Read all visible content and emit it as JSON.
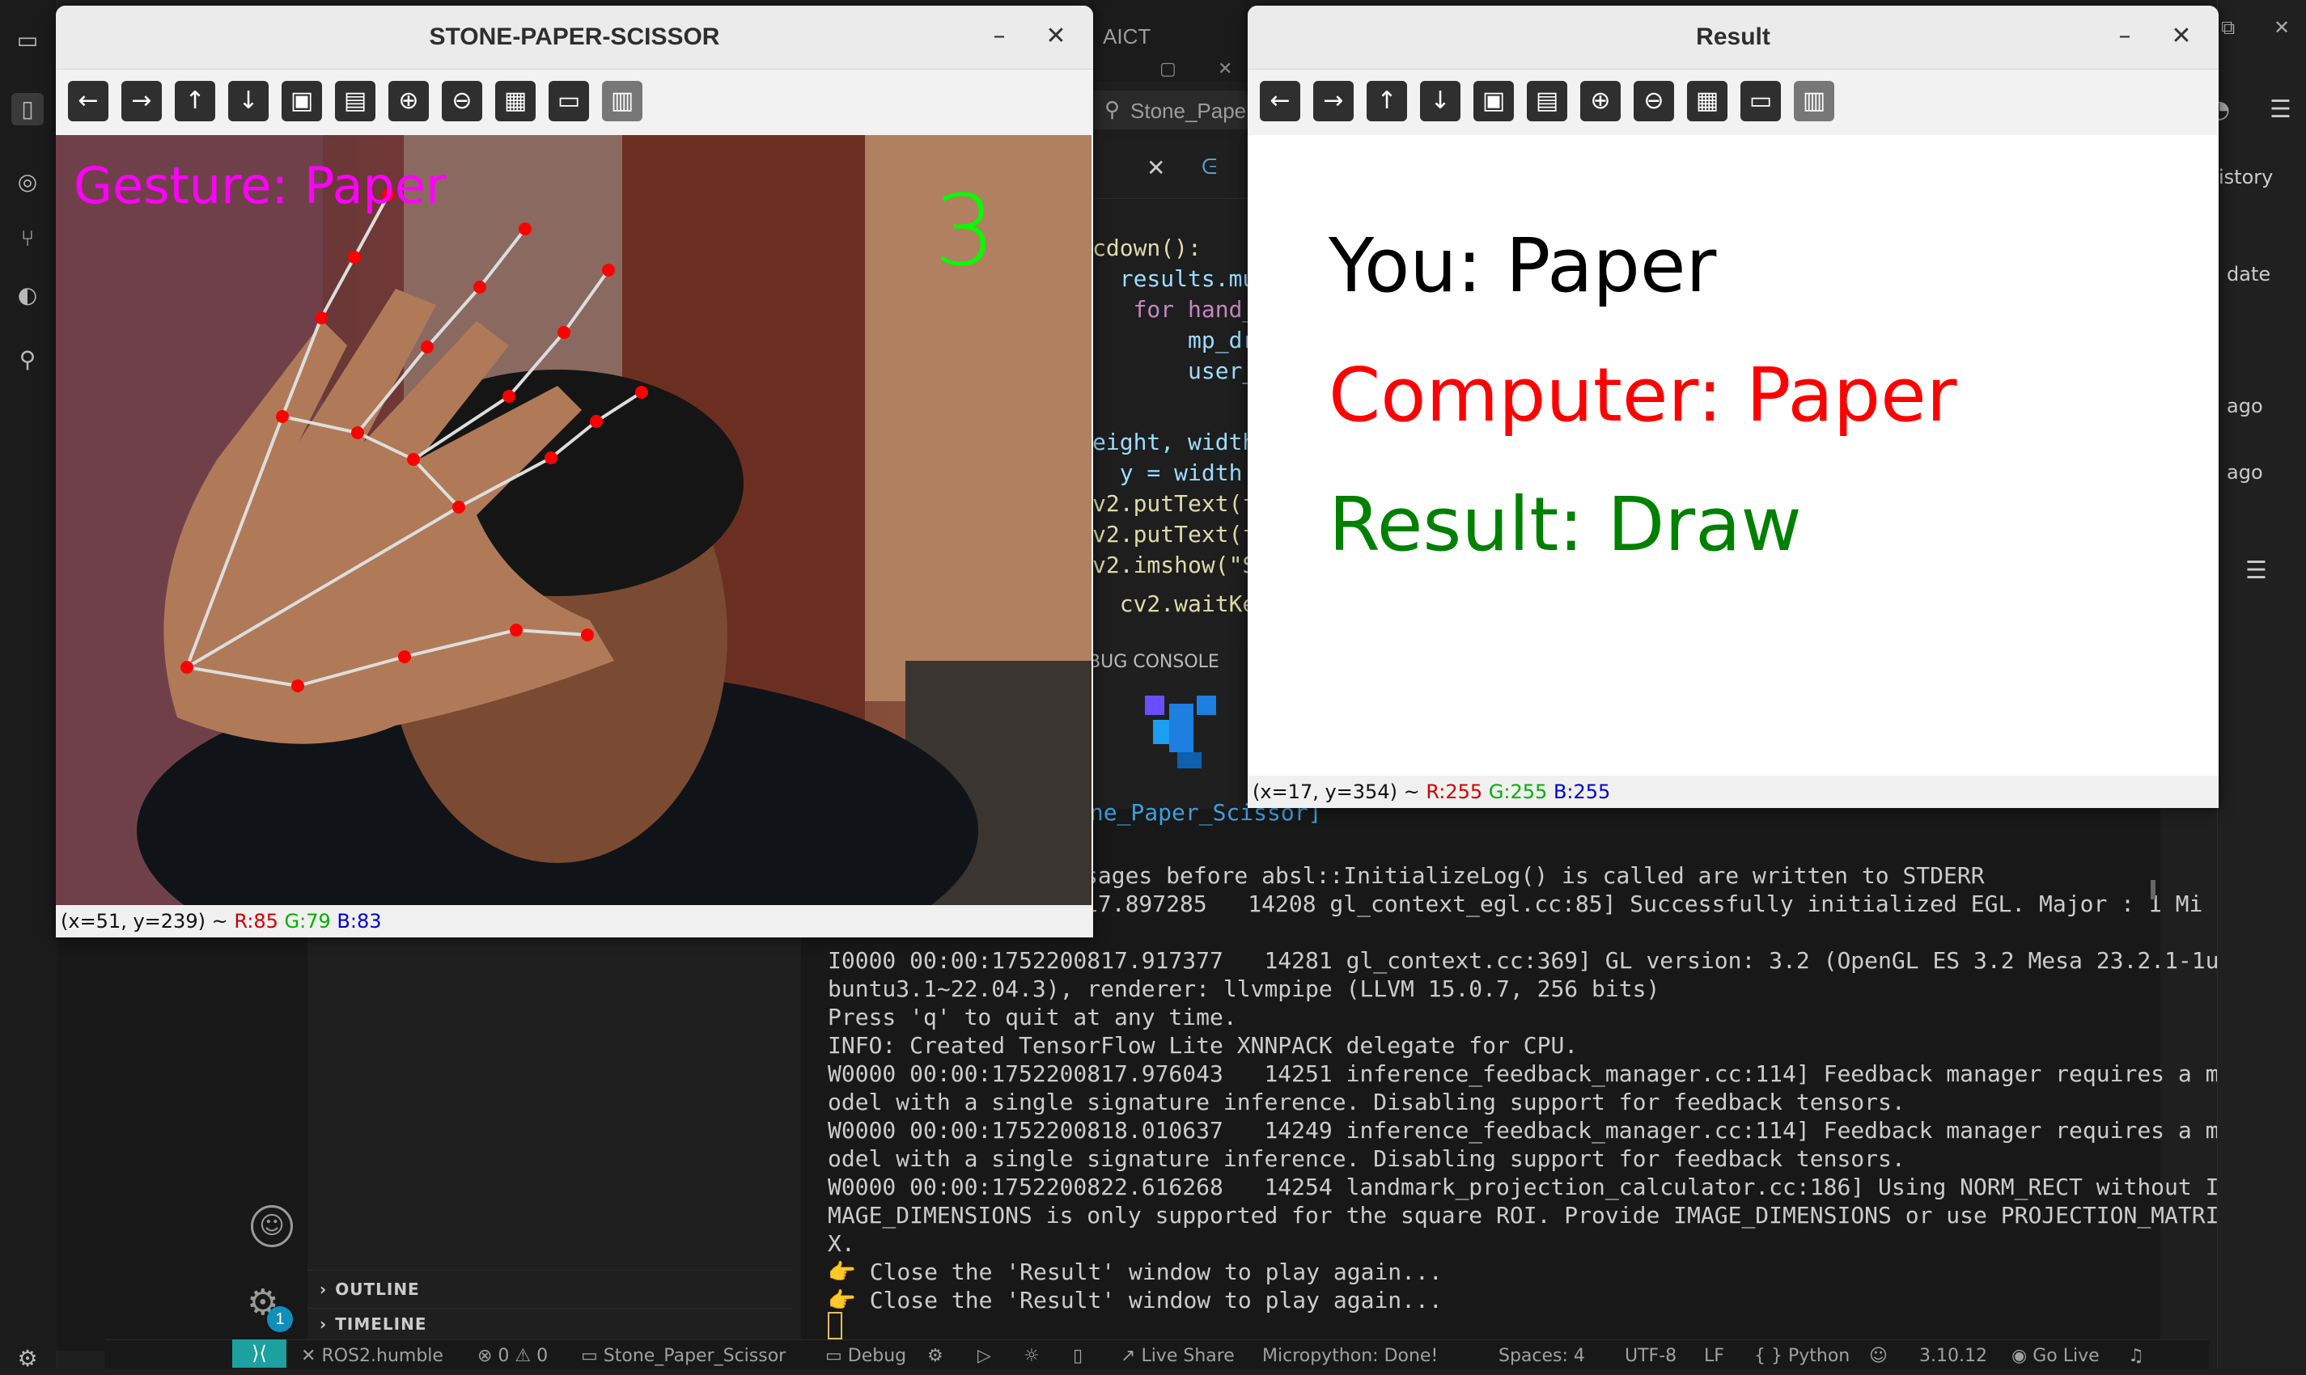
{
  "colors": {
    "gesture_text": "#ff00ff",
    "countdown": "#00ff00",
    "you_text": "#000000",
    "computer_text": "#ff0000",
    "result_text": "#008000",
    "landmark_point": "#ff0000",
    "landmark_line": "#dddddd"
  },
  "camera_window": {
    "title": "STONE-PAPER-SCISSOR",
    "minimize_icon": "–",
    "close_icon": "✕",
    "overlay": {
      "gesture_label": "Gesture: Paper",
      "countdown": "3"
    },
    "status": {
      "coords": "(x=51, y=239) ~ ",
      "r": "R:85",
      "g": "G:79",
      "b": "B:83"
    }
  },
  "result_window": {
    "title": "Result",
    "minimize_icon": "–",
    "close_icon": "✕",
    "lines": {
      "you": "You: Paper",
      "computer": "Computer: Paper",
      "result": "Result: Draw"
    },
    "status": {
      "coords": "(x=17, y=354) ~ ",
      "r": "R:255",
      "g": "G:255",
      "b": "B:255"
    }
  },
  "toolbar_icons": [
    "arrow-left-icon",
    "arrow-right-icon",
    "arrow-up-icon",
    "arrow-down-icon",
    "image-icon",
    "image-settings-icon",
    "zoom-in-icon",
    "zoom-out-icon",
    "save-icon",
    "clipboard-icon",
    "properties-icon"
  ],
  "toolbar_glyphs": [
    "←",
    "→",
    "↑",
    "↓",
    "▣",
    "▤",
    "⊕",
    "⊖",
    "▦",
    "▭",
    "▥"
  ],
  "vscode": {
    "tab_fragment": "AICT",
    "search_fragment": "Stone_Pape",
    "code_lines": [
      "cdown():",
      "  results.mu",
      "   for hand_",
      "       mp_dr",
      "       user_",
      "eight, width",
      "  y = width",
      "v2.putText(f",
      "v2.putText(f",
      "v2.imshow(\"S",
      "  cv2.waitKe"
    ],
    "debug_console_label": "BUG CONSOLE",
    "terminal_name": "one_Paper_Scissor]",
    "terminal_lines": [
      "sages before absl::InitializeLog() is called are written to STDERR",
      "17.897285   14208 gl_context_egl.cc:85] Successfully initialized EGL. Major : 1 Mi",
      "I0000 00:00:1752200817.917377   14281 gl_context.cc:369] GL version: 3.2 (OpenGL ES 3.2 Mesa 23.2.1-1u",
      "buntu3.1~22.04.3), renderer: llvmpipe (LLVM 15.0.7, 256 bits)",
      "Press 'q' to quit at any time.",
      "INFO: Created TensorFlow Lite XNNPACK delegate for CPU.",
      "W0000 00:00:1752200817.976043   14251 inference_feedback_manager.cc:114] Feedback manager requires a m",
      "odel with a single signature inference. Disabling support for feedback tensors.",
      "W0000 00:00:1752200818.010637   14249 inference_feedback_manager.cc:114] Feedback manager requires a m",
      "odel with a single signature inference. Disabling support for feedback tensors.",
      "W0000 00:00:1752200822.616268   14254 landmark_projection_calculator.cc:186] Using NORM_RECT without I",
      "MAGE_DIMENSIONS is only supported for the square ROI. Provide IMAGE_DIMENSIONS or use PROJECTION_MATRI",
      "X.",
      "👉 Close the 'Result' window to play again...",
      "👉 Close the 'Result' window to play again..."
    ],
    "outline_label": "OUTLINE",
    "timeline_label": "TIMELINE",
    "accounts_badge": "1",
    "right_panel": {
      "history": "istory",
      "date": "date",
      "ago1": "ago",
      "ago2": "ago"
    },
    "status_bar": {
      "remote": "ROS2.humble",
      "problems": "⊗ 0 ⚠ 0",
      "folder": "Stone_Paper_Scissor",
      "debug": "Debug",
      "live_share": "Live Share",
      "micropython": "Micropython: Done!",
      "spaces": "Spaces: 4",
      "encoding": "UTF-8",
      "eol": "LF",
      "language": "{ } Python",
      "python_version": "3.10.12",
      "go_live": "Go Live"
    }
  }
}
